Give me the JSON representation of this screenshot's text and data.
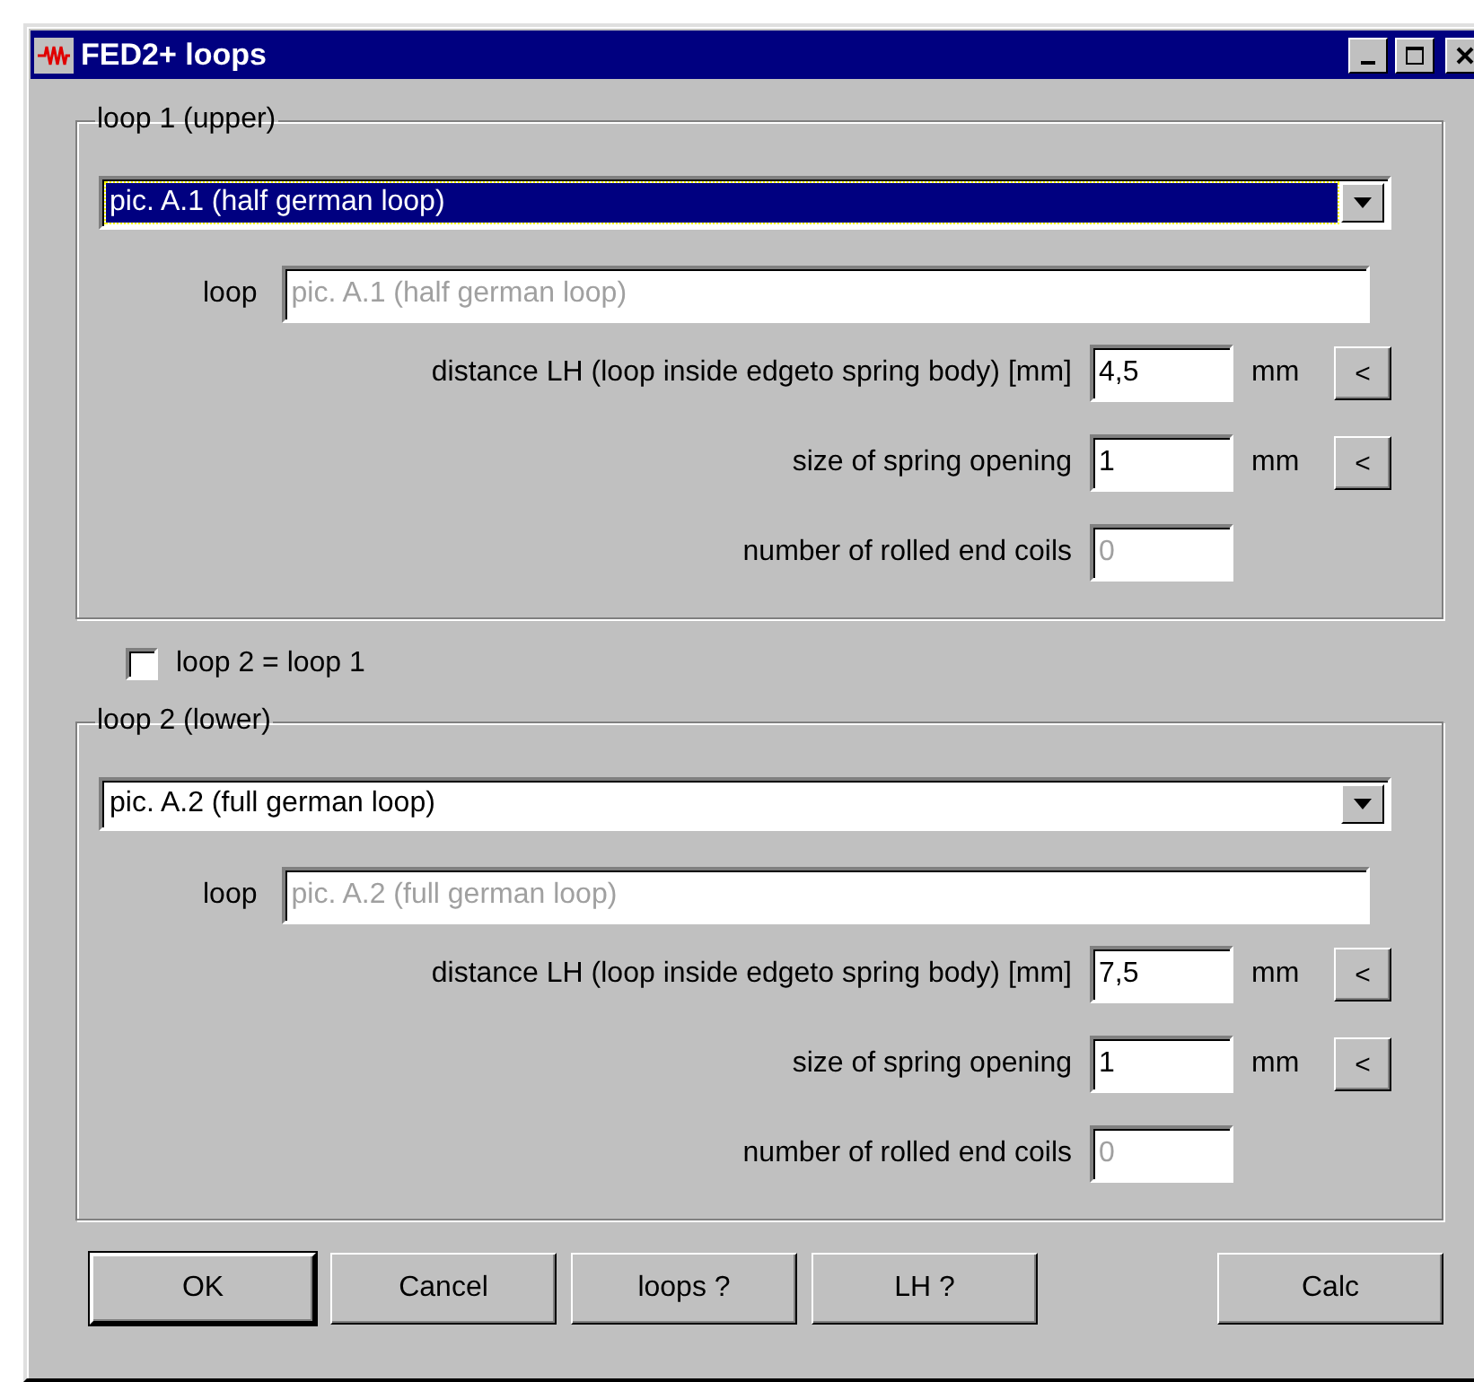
{
  "window": {
    "title": "FED2+ loops"
  },
  "groups": [
    {
      "legend": "loop 1 (upper)",
      "combo": {
        "value": "pic. A.1 (half german loop)",
        "focused": true
      },
      "loop_label": "loop",
      "loop_field": {
        "value": "pic. A.1 (half german loop)",
        "disabled": true
      },
      "fields": [
        {
          "label": "distance LH (loop inside edgeto spring body) [mm]",
          "value": "4,5",
          "disabled": false,
          "unit": "mm",
          "button": "<"
        },
        {
          "label": "size of spring opening",
          "value": "1",
          "disabled": false,
          "unit": "mm",
          "button": "<"
        },
        {
          "label": "number of rolled end coils",
          "value": "0",
          "disabled": true
        }
      ]
    },
    {
      "legend": "loop 2 (lower)",
      "combo": {
        "value": "pic. A.2 (full german loop)",
        "focused": false
      },
      "loop_label": "loop",
      "loop_field": {
        "value": "pic. A.2 (full german loop)",
        "disabled": true
      },
      "fields": [
        {
          "label": "distance LH (loop inside edgeto spring body) [mm]",
          "value": "7,5",
          "disabled": false,
          "unit": "mm",
          "button": "<"
        },
        {
          "label": "size of spring opening",
          "value": "1",
          "disabled": false,
          "unit": "mm",
          "button": "<"
        },
        {
          "label": "number of rolled end coils",
          "value": "0",
          "disabled": true
        }
      ]
    }
  ],
  "checkbox": {
    "label": "loop 2 = loop 1",
    "checked": false
  },
  "buttons": [
    {
      "label": "OK",
      "default": true
    },
    {
      "label": "Cancel",
      "default": false
    },
    {
      "label": "loops ?",
      "default": false
    },
    {
      "label": "LH ?",
      "default": false
    },
    {
      "label": "Calc",
      "default": false
    }
  ]
}
